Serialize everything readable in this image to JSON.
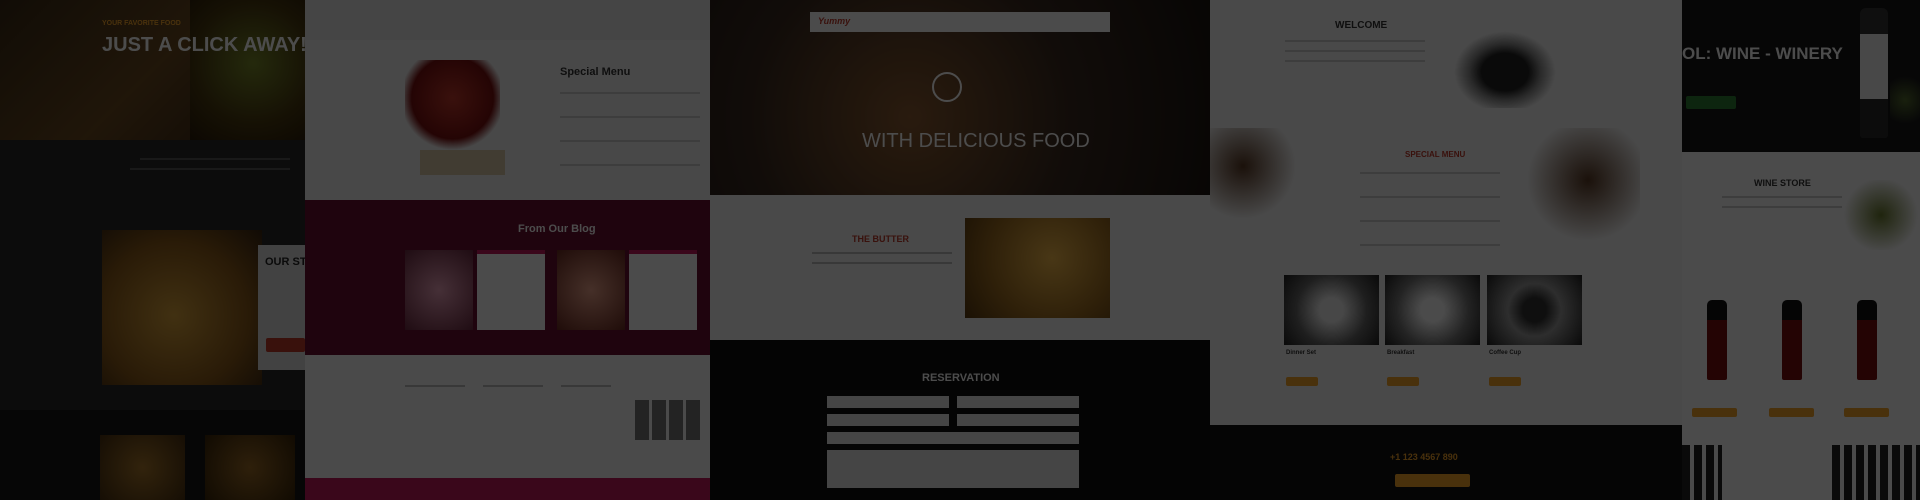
{
  "panel1": {
    "eyebrow": "YOUR FAVORITE FOOD",
    "headline": "JUST A CLICK AWAY!",
    "story_heading": "OUR STO"
  },
  "panel2": {
    "menu_heading": "Special Menu",
    "blog_heading": "From Our Blog"
  },
  "panel3": {
    "hero_line": "WITH DELICIOUS FOOD",
    "butter_heading": "THE BUTTER",
    "reservation_heading": "RESERVATION",
    "logo_text": "Yummy"
  },
  "panel4": {
    "welcome_heading": "WELCOME",
    "special_menu_heading": "SPECIAL MENU",
    "phone_text": "+1 123 4567 890",
    "product_names": [
      "Dinner Set",
      "Breakfast",
      "Coffee Cup"
    ]
  },
  "panel5": {
    "headline": "OL: WINE - WINERY",
    "wine_store_heading": "WINE STORE"
  },
  "colors": {
    "accent_orange": "#f4a42a",
    "accent_red": "#c0392b",
    "brand_pink": "#c2185b"
  }
}
